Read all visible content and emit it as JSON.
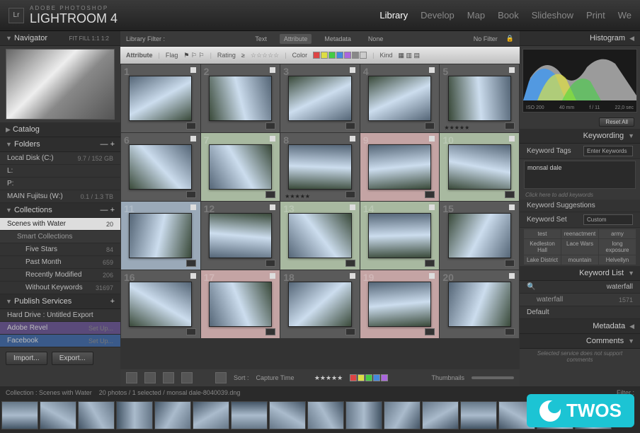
{
  "app": {
    "vendor": "ADOBE PHOTOSHOP",
    "title": "LIGHTROOM 4",
    "logo": "Lr"
  },
  "modules": [
    "Library",
    "Develop",
    "Map",
    "Book",
    "Slideshow",
    "Print",
    "We"
  ],
  "activeModule": "Library",
  "navigator": {
    "title": "Navigator",
    "opts": "FIT   FILL   1:1   1:2"
  },
  "catalog": {
    "title": "Catalog"
  },
  "folders": {
    "title": "Folders",
    "items": [
      {
        "label": "Local Disk (C:)",
        "count": "9.7 / 152 GB"
      },
      {
        "label": "L:",
        "count": ""
      },
      {
        "label": "P:",
        "count": ""
      },
      {
        "label": "MAIN Fujitsu (W:)",
        "count": "0.1 / 1.3 TB"
      }
    ]
  },
  "collections": {
    "title": "Collections",
    "items": [
      {
        "label": "Scenes with Water",
        "count": "20",
        "selected": true
      },
      {
        "label": "Smart Collections",
        "count": "",
        "header": true
      },
      {
        "label": "Five Stars",
        "count": "84"
      },
      {
        "label": "Past Month",
        "count": "659"
      },
      {
        "label": "Recently Modified",
        "count": "206"
      },
      {
        "label": "Without Keywords",
        "count": "31697"
      }
    ]
  },
  "publish": {
    "title": "Publish Services",
    "items": [
      {
        "label": "Hard Drive : Untitled Export",
        "count": ""
      },
      {
        "label": "Adobe Revel",
        "count": "Set Up..."
      },
      {
        "label": "Facebook",
        "count": "Set Up..."
      }
    ]
  },
  "importBtn": "Import...",
  "exportBtn": "Export...",
  "filterBar": {
    "title": "Library Filter :",
    "tabs": [
      "Text",
      "Attribute",
      "Metadata",
      "None"
    ],
    "active": "Attribute",
    "preset": "No Filter"
  },
  "attrBar": {
    "title": "Attribute",
    "flag": "Flag",
    "rating": "Rating",
    "ratingOp": "≥",
    "color": "Color",
    "kind": "Kind",
    "colors": [
      "#d44",
      "#dd4",
      "#4c4",
      "#48d",
      "#a6d",
      "#888",
      "#ccc"
    ]
  },
  "gridCells": [
    {
      "n": "1",
      "cls": ""
    },
    {
      "n": "2",
      "cls": ""
    },
    {
      "n": "3",
      "cls": ""
    },
    {
      "n": "4",
      "cls": ""
    },
    {
      "n": "5",
      "cls": "",
      "rating": "★★★★★"
    },
    {
      "n": "6",
      "cls": ""
    },
    {
      "n": "7",
      "cls": "g"
    },
    {
      "n": "8",
      "cls": "",
      "rating": "★★★★★"
    },
    {
      "n": "9",
      "cls": "r"
    },
    {
      "n": "10",
      "cls": "g"
    },
    {
      "n": "11",
      "cls": "sel"
    },
    {
      "n": "12",
      "cls": ""
    },
    {
      "n": "13",
      "cls": "g"
    },
    {
      "n": "14",
      "cls": "g"
    },
    {
      "n": "15",
      "cls": ""
    },
    {
      "n": "16",
      "cls": ""
    },
    {
      "n": "17",
      "cls": "r"
    },
    {
      "n": "18",
      "cls": ""
    },
    {
      "n": "19",
      "cls": "r"
    },
    {
      "n": "20",
      "cls": ""
    }
  ],
  "toolbar": {
    "sort": "Sort :",
    "sortBy": "Capture Time"
  },
  "status": {
    "collection": "Collection : Scenes with Water",
    "count": "20 photos / 1 selected / monsal dale-8040039.dng",
    "filter": "Filter :"
  },
  "histogram": {
    "title": "Histogram",
    "iso": "ISO 200",
    "focal": "40 mm",
    "aperture": "f / 11",
    "shutter": "22,0 sec",
    "resetBtn": "Reset All"
  },
  "keywording": {
    "title": "Keywording",
    "tagsLabel": "Keyword Tags",
    "enterPlaceholder": "Enter Keywords",
    "value": "monsal dale",
    "addHint": "Click here to add keywords",
    "suggTitle": "Keyword Suggestions",
    "setTitle": "Keyword Set",
    "setValue": "Custom",
    "grid": [
      "test",
      "reenactment",
      "army",
      "Kedleston Hall",
      "Lace Wars",
      "long exposure",
      "Lake District",
      "mountain",
      "Helvellyn"
    ]
  },
  "keywordList": {
    "title": "Keyword List",
    "search": "waterfall",
    "item": "waterfall",
    "itemCount": "1571",
    "default": "Default"
  },
  "metadata": {
    "title": "Metadata"
  },
  "comments": {
    "title": "Comments",
    "note": "Selected service does not support comments"
  },
  "watermark": "TWOS"
}
